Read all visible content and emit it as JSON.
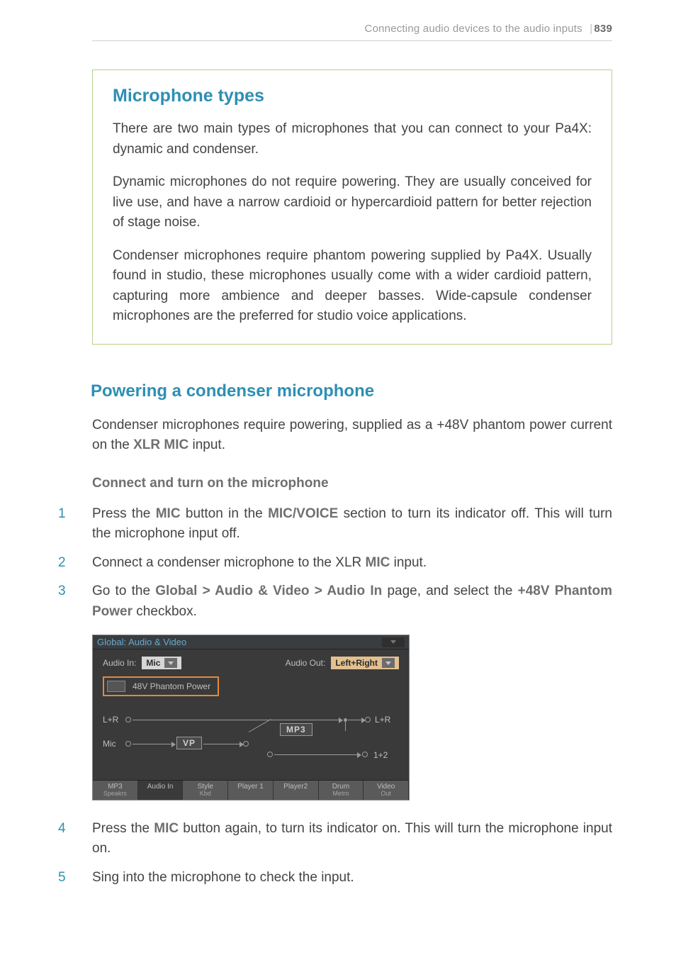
{
  "header": {
    "section": "Connecting audio devices to the audio inputs",
    "pagenum": "839"
  },
  "callout": {
    "title": "Microphone types",
    "p1": "There are two main types of microphones that you can connect to your Pa4X: dynamic and condenser.",
    "p2": "Dynamic microphones do not require powering. They are usually conceived for live use, and have a narrow cardioid or hypercardioid pattern for better rejection of stage noise.",
    "p3": "Condenser microphones require phantom powering supplied by Pa4X. Usually found in studio, these microphones usually come with a wider cardioid pattern, capturing more ambience and deeper basses. Wide-capsule condenser microphones are the preferred for studio voice applications."
  },
  "section": {
    "title": "Powering a condenser microphone",
    "intro_pre": "Condenser microphones require powering, supplied as a +48V phantom power current on the ",
    "intro_ui": "XLR MIC",
    "intro_post": " input.",
    "subhead": "Connect and turn on the microphone"
  },
  "steps": {
    "s1_a": "Press the ",
    "s1_mic": "MIC",
    "s1_b": " button in the ",
    "s1_micvoice": "MIC/VOICE",
    "s1_c": " section to turn its indicator off. This will turn the microphone input off.",
    "s2_a": "Connect a condenser microphone to the XLR ",
    "s2_mic": "MIC",
    "s2_b": " input.",
    "s3_a": "Go to the ",
    "s3_path": "Global > Audio & Video > Audio In",
    "s3_b": " page, and select the ",
    "s3_opt": "+48V Phantom Power",
    "s3_c": " checkbox.",
    "s4_a": "Press the ",
    "s4_mic": "MIC",
    "s4_b": " button again, to turn its indicator on. This will turn the microphone input on.",
    "s5": "Sing into the microphone to check the input."
  },
  "figure": {
    "title": "Global: Audio & Video",
    "audio_in_label": "Audio In:",
    "audio_in_value": "Mic",
    "audio_out_label": "Audio Out:",
    "audio_out_value": "Left+Right",
    "phantom": "48V Phantom Power",
    "diagram": {
      "lr": "L+R",
      "mic": "Mic",
      "vp": "VP",
      "mp3": "MP3",
      "outlr": "L+R",
      "out12": "1+2"
    },
    "tabs": {
      "t1a": "MP3",
      "t1b": "Speakrs",
      "t2": "Audio In",
      "t3a": "Style",
      "t3b": "Kbd",
      "t4": "Player 1",
      "t5": "Player2",
      "t6a": "Drum",
      "t6b": "Metro",
      "t7a": "Video",
      "t7b": "Out"
    }
  }
}
